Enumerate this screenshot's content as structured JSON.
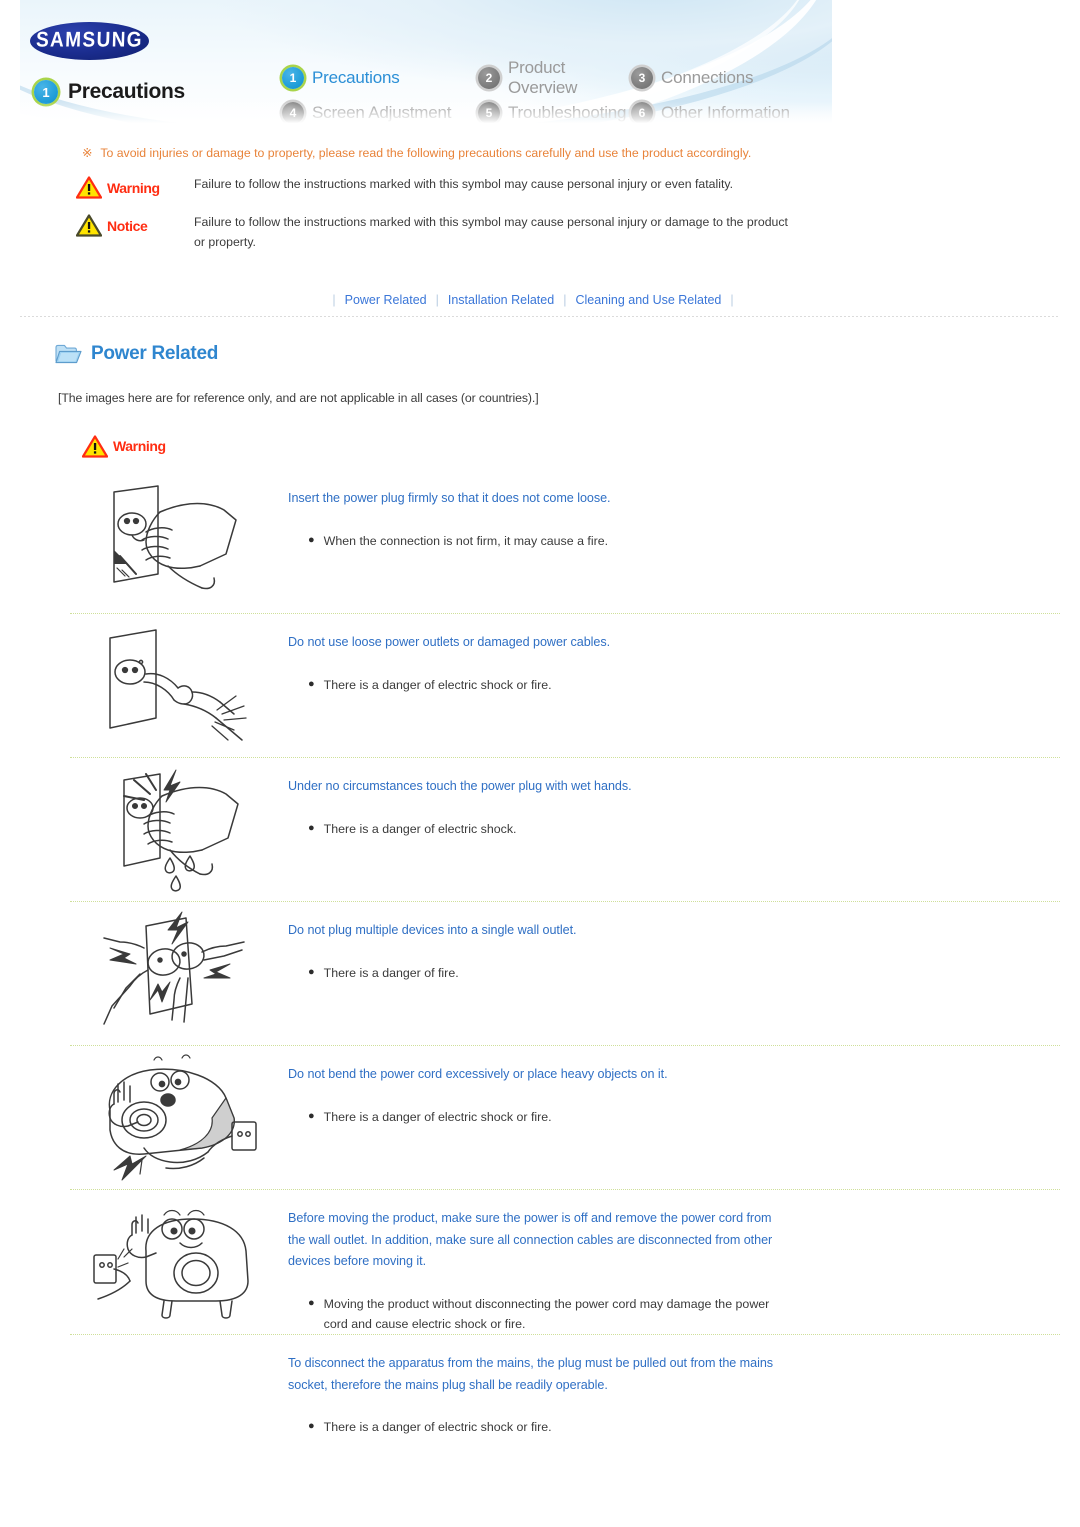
{
  "header": {
    "brand": "SAMSUNG",
    "section_badge": "1",
    "section_title": "Precautions",
    "nav": [
      {
        "num": "1",
        "label": "Precautions",
        "current": true
      },
      {
        "num": "2",
        "label": "Product Overview",
        "current": false
      },
      {
        "num": "3",
        "label": "Connections",
        "current": false
      },
      {
        "num": "4",
        "label": "Screen Adjustment",
        "current": false
      },
      {
        "num": "5",
        "label": "Troubleshooting",
        "current": false
      },
      {
        "num": "6",
        "label": "Other Information",
        "current": false
      }
    ]
  },
  "intro": {
    "mark": "※",
    "note": "To avoid injuries or damage to property, please read the following precautions carefully and use the product accordingly.",
    "legend": [
      {
        "key": "Warning",
        "icon": "warning-triangle-icon",
        "desc": "Failure to follow the instructions marked with this symbol may cause personal injury or even fatality."
      },
      {
        "key": "Notice",
        "icon": "notice-triangle-icon",
        "desc": "Failure to follow the instructions marked with this symbol may cause personal injury or damage to the product or property."
      }
    ]
  },
  "subnav": {
    "separator": "|",
    "links": [
      "Power Related",
      "Installation Related",
      "Cleaning and Use Related"
    ]
  },
  "power_related": {
    "icon": "folder-icon",
    "title": "Power Related",
    "reference_note": "[The images here are for reference only, and are not applicable in all cases (or countries).]",
    "warning_label": "Warning",
    "items": [
      {
        "figure": "plug-into-outlet-icon",
        "title": "Insert the power plug firmly so that it does not come loose.",
        "bullets": [
          "When the connection is not firm, it may cause a fire."
        ]
      },
      {
        "figure": "damaged-cable-icon",
        "title": "Do not use loose power outlets or damaged power cables.",
        "bullets": [
          "There is a danger of electric shock or fire."
        ]
      },
      {
        "figure": "wet-hands-icon",
        "title": "Under no circumstances touch the power plug with wet hands.",
        "bullets": [
          "There is a danger of electric shock."
        ]
      },
      {
        "figure": "multi-plug-outlet-icon",
        "title": "Do not plug multiple devices into a single wall outlet.",
        "bullets": [
          "There is a danger of fire."
        ]
      },
      {
        "figure": "bent-cord-projector-icon",
        "title": "Do not bend the power cord excessively or place heavy objects on it.",
        "bullets": [
          "There is a danger of electric shock or fire."
        ]
      },
      {
        "figure": "unplug-before-moving-icon",
        "title": "Before moving the product, make sure the power is off and remove the power cord from the wall outlet. In addition, make sure all connection cables are disconnected from other devices before moving it.",
        "bullets": [
          "Moving the product without disconnecting the power cord may damage the power cord and cause electric shock or fire."
        ]
      },
      {
        "figure": "",
        "title": "To disconnect the apparatus from the mains, the plug must be pulled out from the mains socket, therefore the mains plug shall be readily operable.",
        "bullets": [
          "There is a danger of electric shock or fire."
        ]
      }
    ]
  },
  "colors": {
    "link_blue": "#3a76d8",
    "title_blue": "#2f6fc4",
    "heading_blue": "#2f86cf",
    "nav_active": "#2b8fd6",
    "nav_inactive": "#9a9a9a",
    "warning_red": "#ff2d12",
    "note_orange": "#e8833a",
    "divider_green": "#cfe09a",
    "badge_ring": "#a9d44a",
    "samsung_navy": "#1b2d8f"
  }
}
